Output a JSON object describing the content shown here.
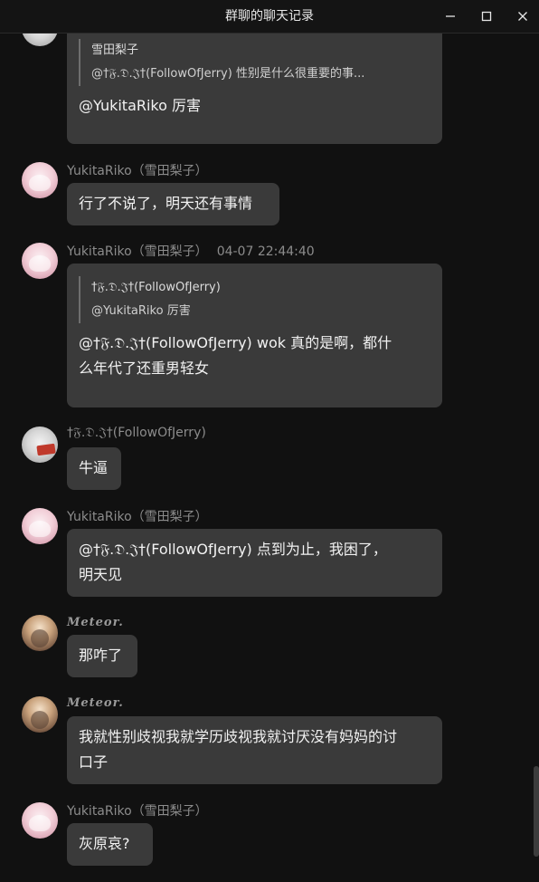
{
  "window": {
    "title": "群聊的聊天记录"
  },
  "messages": [
    {
      "quote_name": "雪田梨子",
      "quote_text": "@†𝔉.𝔇.𝔍†(FollowOfJerry) 性别是什么很重要的事...",
      "text": "@YukitaRiko 厉害"
    },
    {
      "sender": "YukitaRiko（雪田梨子）",
      "text": "行了不说了，明天还有事情"
    },
    {
      "sender": "YukitaRiko（雪田梨子）",
      "time": "04-07 22:44:40",
      "quote_name": "†𝔉.𝔇.𝔍†(FollowOfJerry)",
      "quote_text": "@YukitaRiko 厉害",
      "text_line1": "@†𝔉.𝔇.𝔍†(FollowOfJerry) wok 真的是啊，都什",
      "text_line2": "么年代了还重男轻女"
    },
    {
      "sender": "†𝔉.𝔇.𝔍†(FollowOfJerry)",
      "text": "牛逼"
    },
    {
      "sender": "YukitaRiko（雪田梨子）",
      "text_line1": "@†𝔉.𝔇.𝔍†(FollowOfJerry) 点到为止，我困了，",
      "text_line2": "明天见"
    },
    {
      "sender": "Meteor.",
      "text": "那咋了"
    },
    {
      "sender": "Meteor.",
      "text_line1": "我就性别歧视我就学历歧视我就讨厌没有妈妈的讨",
      "text_line2": "口子"
    },
    {
      "sender": "YukitaRiko（雪田梨子）",
      "text": "灰原哀?"
    }
  ]
}
